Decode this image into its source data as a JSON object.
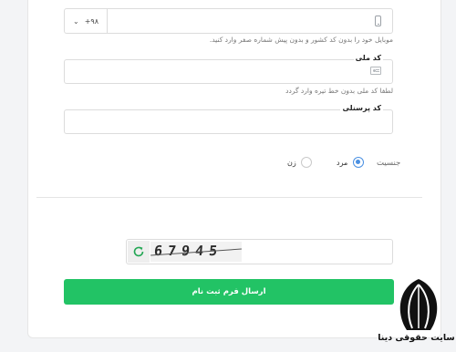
{
  "phone": {
    "country_code": "+۹۸",
    "hint": "موبایل خود را بدون کد کشور و بدون پیش شماره صفر وارد کنید."
  },
  "national_id": {
    "label": "کد ملی",
    "hint": "لطفا کد ملی بدون خط تیره وارد گردد"
  },
  "personnel_code": {
    "label": "کد پرسنلی"
  },
  "gender": {
    "label": "جنسیت",
    "options": [
      "مرد",
      "زن"
    ],
    "selected": "مرد"
  },
  "captcha": {
    "text": "67945"
  },
  "submit_label": "ارسال فرم ثبت نام",
  "watermark": {
    "text": "سایت حقوقی دینا"
  },
  "colors": {
    "accent": "#22c365",
    "radio": "#4a90e2"
  }
}
